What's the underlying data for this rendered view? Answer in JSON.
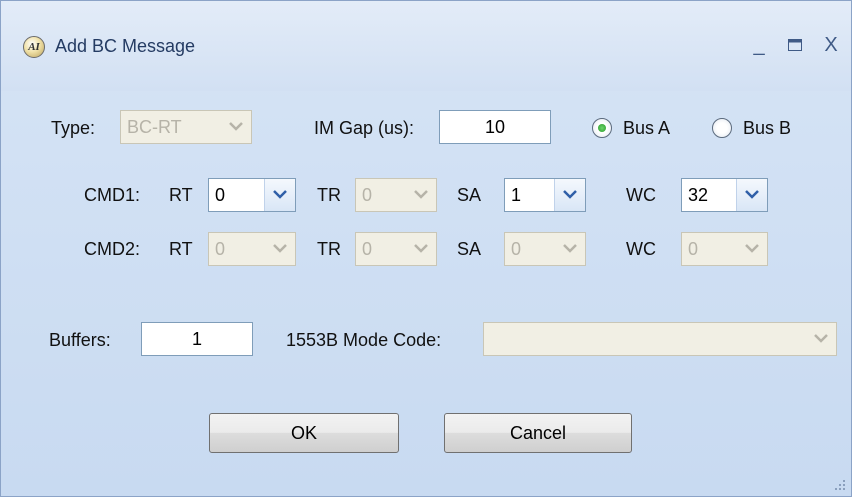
{
  "window": {
    "title": "Add BC Message",
    "icon_text": "AI",
    "controls": {
      "minimize": "_",
      "maximize": "▬",
      "close": "X"
    }
  },
  "row1": {
    "type_label": "Type:",
    "type_value": "BC-RT",
    "gap_label": "IM Gap (us):",
    "gap_value": "10",
    "bus_a_label": "Bus A",
    "bus_b_label": "Bus B",
    "selected_bus": "Bus A"
  },
  "cmd1": {
    "label": "CMD1:",
    "rt_label": "RT",
    "rt_value": "0",
    "tr_label": "TR",
    "tr_value": "0",
    "sa_label": "SA",
    "sa_value": "1",
    "wc_label": "WC",
    "wc_value": "32"
  },
  "cmd2": {
    "label": "CMD2:",
    "rt_label": "RT",
    "rt_value": "0",
    "tr_label": "TR",
    "tr_value": "0",
    "sa_label": "SA",
    "sa_value": "0",
    "wc_label": "WC",
    "wc_value": "0"
  },
  "row4": {
    "buffers_label": "Buffers:",
    "buffers_value": "1",
    "mode_code_label": "1553B Mode Code:",
    "mode_code_value": ""
  },
  "buttons": {
    "ok": "OK",
    "cancel": "Cancel"
  },
  "colors": {
    "background": "#c8daf1",
    "title_text": "#243b63",
    "arrow_enabled": "#2f5fa8",
    "arrow_disabled": "#b6b3a8",
    "radio_selected": "#2a9a2a"
  }
}
